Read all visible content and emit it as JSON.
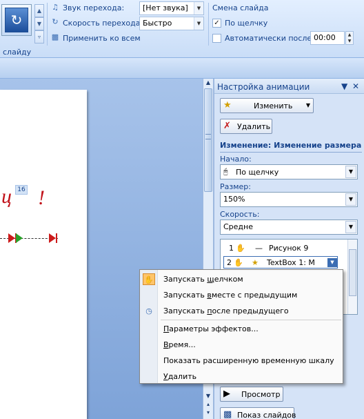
{
  "ribbon": {
    "transition_sound_label": "Звук перехода:",
    "transition_sound_value": "[Нет звука]",
    "transition_speed_label": "Скорость перехода:",
    "transition_speed_value": "Быстро",
    "apply_all_label": "Применить ко всем",
    "advance_slide_title": "Смена слайда",
    "on_click_label": "По щелчку",
    "on_click_checked": true,
    "auto_after_label": "Автоматически после:",
    "auto_after_checked": false,
    "auto_after_value": "00:00",
    "group_label_fragment": "слайду"
  },
  "slide": {
    "text_fragment": "ц",
    "exclamation": "!",
    "anim_tag": "16"
  },
  "task_pane": {
    "title": "Настройка анимации",
    "change_button": "Изменить",
    "delete_button": "Удалить",
    "section_title": "Изменение: Изменение размера",
    "start_label": "Начало:",
    "start_value": "По щелчку",
    "size_label": "Размер:",
    "size_value": "150%",
    "speed_label": "Скорость:",
    "speed_value": "Средне",
    "animation_items": [
      {
        "order": "1",
        "name": "Рисунок 9"
      },
      {
        "order": "2",
        "name": "TextBox 1: М"
      }
    ],
    "preview_button": "Просмотр",
    "slideshow_button": "Показ слайдов"
  },
  "context_menu": {
    "items": [
      {
        "label_pre": "Запускать ",
        "label_u": "щ",
        "label_post": "елчком",
        "checked": true
      },
      {
        "label_pre": "Запускать ",
        "label_u": "в",
        "label_post": "месте с предыдущим",
        "checked": false
      },
      {
        "label_pre": "Запускать ",
        "label_u": "п",
        "label_post": "осле предыдущего",
        "checked": false
      },
      {
        "label_pre": "",
        "label_u": "П",
        "label_post": "араметры эффектов...",
        "checked": false
      },
      {
        "label_pre": "",
        "label_u": "В",
        "label_post": "ремя...",
        "checked": false
      },
      {
        "label_pre": "",
        "label_u": "",
        "label_post": "Показать расширенную временную шкалу",
        "checked": false
      },
      {
        "label_pre": "",
        "label_u": "У",
        "label_post": "далить",
        "checked": false
      }
    ]
  },
  "colors": {
    "ribbon_text": "#15428b",
    "menu_check_bg": "#ffc56a",
    "slide_text": "#c1121a"
  }
}
